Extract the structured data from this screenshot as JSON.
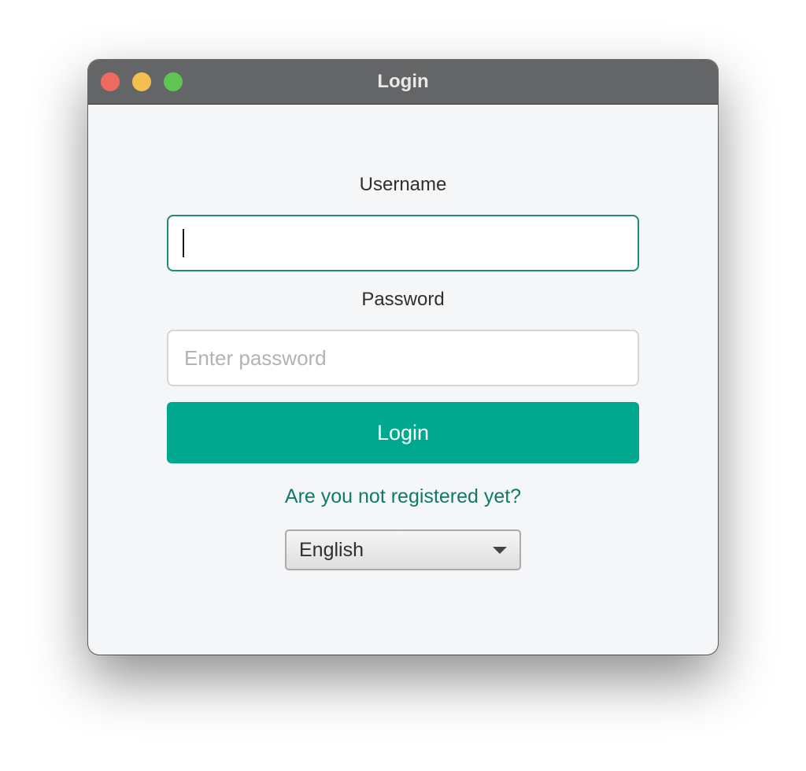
{
  "window": {
    "title": "Login",
    "controls": {
      "close_color": "#ee6a5e",
      "minimize_color": "#f5bf4f",
      "maximize_color": "#61c554"
    }
  },
  "form": {
    "username_label": "Username",
    "username_value": "",
    "username_placeholder": "",
    "password_label": "Password",
    "password_placeholder": "Enter password",
    "login_button_label": "Login",
    "register_link_text": "Are you not registered yet?",
    "language_selected": "English"
  },
  "colors": {
    "accent": "#00a88f",
    "link": "#107a68",
    "focus_border": "#1e8c78"
  }
}
